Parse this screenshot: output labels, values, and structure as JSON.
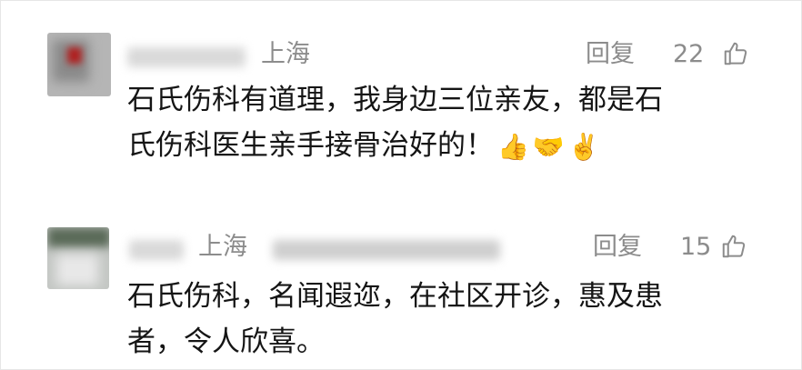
{
  "comments": [
    {
      "location": "上海",
      "reply_label": "回复",
      "likes": "22",
      "text_lines": [
        "石氏伤科有道理，我身边三位亲友，都是石",
        "氏伤科医生亲手接骨治好的！"
      ],
      "emojis": [
        "👍",
        "🤝",
        "✌️"
      ]
    },
    {
      "location": "上海",
      "reply_label": "回复",
      "likes": "15",
      "text_lines": [
        "石氏伤科，名闻遐迩，在社区开诊，惠及患",
        "者，令人欣喜。"
      ]
    }
  ],
  "icons": {
    "like": "thumb-up-icon"
  },
  "colors": {
    "meta_gray": "#8c8c8c",
    "text": "#151515"
  }
}
